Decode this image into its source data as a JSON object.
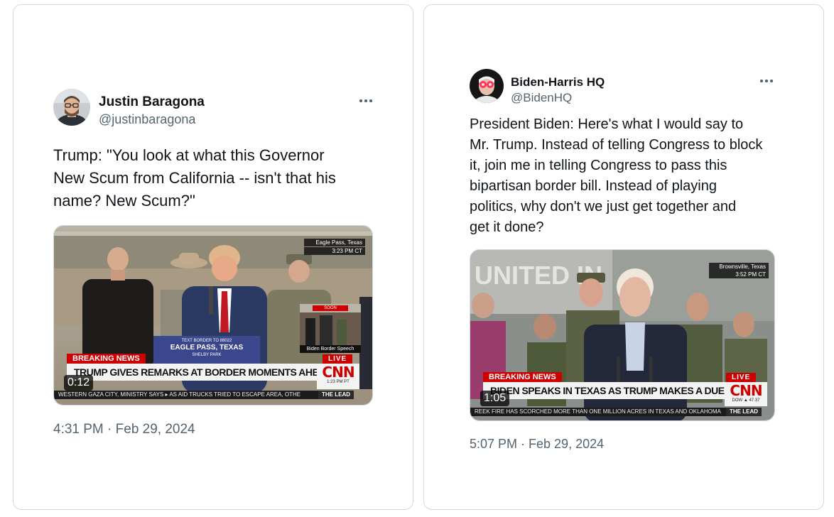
{
  "tweets": [
    {
      "display_name": "Justin Baragona",
      "handle": "@justinbaragona",
      "text": "Trump: \"You look at what this Governor\nNew Scum from California -- isn't that his\nname? New Scum?\"",
      "timestamp": "4:31 PM · Feb 29, 2024",
      "avatar_icon": "avatar-man-glasses",
      "media": {
        "duration": "0:12",
        "location": "Eagle Pass, Texas",
        "time": "3:23 PM CT",
        "breaking": "BREAKING NEWS",
        "live": "LIVE",
        "headline": "TRUMP GIVES REMARKS AT BORDER MOMENTS AHEAD OF BIDEN",
        "network": "CNN",
        "clock": "1:23 PM PT",
        "ticker": "WESTERN GAZA CITY, MINISTRY SAYS   ▸  AS AID TRUCKS TRIED TO ESCAPE AREA, OTHE",
        "show": "THE LEAD",
        "podium_top": "TEXT BORDER TO 88022",
        "podium_main": "EAGLE PASS, TEXAS",
        "podium_bottom": "SHELBY PARK",
        "inset_label": "Biden Border Speech",
        "inset_soon": "SOON"
      }
    },
    {
      "display_name": "Biden-Harris HQ",
      "handle": "@BidenHQ",
      "text": "President Biden: Here's what I would say to\nMr. Trump. Instead of telling Congress to block\nit, join me in telling Congress to pass this\nbipartisan border bill. Instead of playing\npolitics, why don't we just get together and\nget it done?",
      "timestamp": "5:07 PM · Feb 29, 2024",
      "avatar_icon": "avatar-laser-eyes",
      "media": {
        "duration": "1:05",
        "location": "Brownsville, Texas",
        "time": "3:52 PM CT",
        "breaking": "BREAKING NEWS",
        "live": "LIVE",
        "headline": "BIDEN SPEAKS IN TEXAS AS TRUMP MAKES A DUELING BORDER VISIT",
        "network": "CNN",
        "clock": "DOW ▲ 47.37",
        "ticker": "REEK FIRE HAS SCORCHED MORE THAN ONE MILLION ACRES IN TEXAS AND OKLAHOMA",
        "show": "THE LEAD",
        "backdrop_text": "UNITED IN"
      }
    }
  ],
  "colors": {
    "text_primary": "#0f1419",
    "text_secondary": "#536471",
    "border": "#cfd9de",
    "cnn_red": "#cc0000"
  }
}
